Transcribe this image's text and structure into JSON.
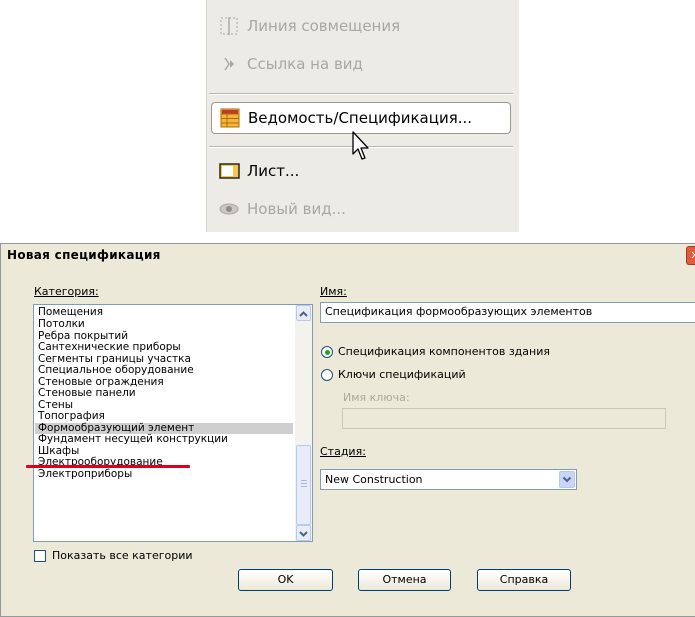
{
  "menu": {
    "items": [
      {
        "label": "Линия совмещения",
        "icon": "alignment-line-icon",
        "disabled": true
      },
      {
        "label": "Ссылка на вид",
        "icon": "view-reference-icon",
        "disabled": true
      },
      {
        "label": "Ведомость/Спецификация...",
        "icon": "schedule-table-icon",
        "disabled": false,
        "highlighted": true
      },
      {
        "label": "Лист...",
        "icon": "sheet-icon",
        "disabled": false
      },
      {
        "label": "Новый вид...",
        "icon": "eye-icon",
        "disabled": true
      }
    ]
  },
  "dialog": {
    "title": "Новая спецификация",
    "close_label": "✕",
    "category_label": "Категория:",
    "categories": [
      "Помещения",
      "Потолки",
      "Ребра покрытий",
      "Сантехнические приборы",
      "Сегменты границы участка",
      "Специальное оборудование",
      "Стеновые ограждения",
      "Стеновые панели",
      "Стены",
      "Топография",
      "Формообразующий элемент",
      "Фундамент несущей конструкции",
      "Шкафы",
      "Электрооборудование",
      "Электроприборы"
    ],
    "selected_category": "Формообразующий элемент",
    "show_all_label": "Показать все категории",
    "name_label": "Имя:",
    "name_value": "Спецификация формообразующих элементов",
    "radio_components": "Спецификация компонентов здания",
    "radio_keys": "Ключи спецификаций",
    "key_name_label": "Имя ключа:",
    "phase_label": "Стадия:",
    "phase_value": "New Construction",
    "ok": "OK",
    "cancel": "Отмена",
    "help": "Справка"
  },
  "colors": {
    "annotation_underline": "#e0001a",
    "radio_selected": "#21a121"
  }
}
